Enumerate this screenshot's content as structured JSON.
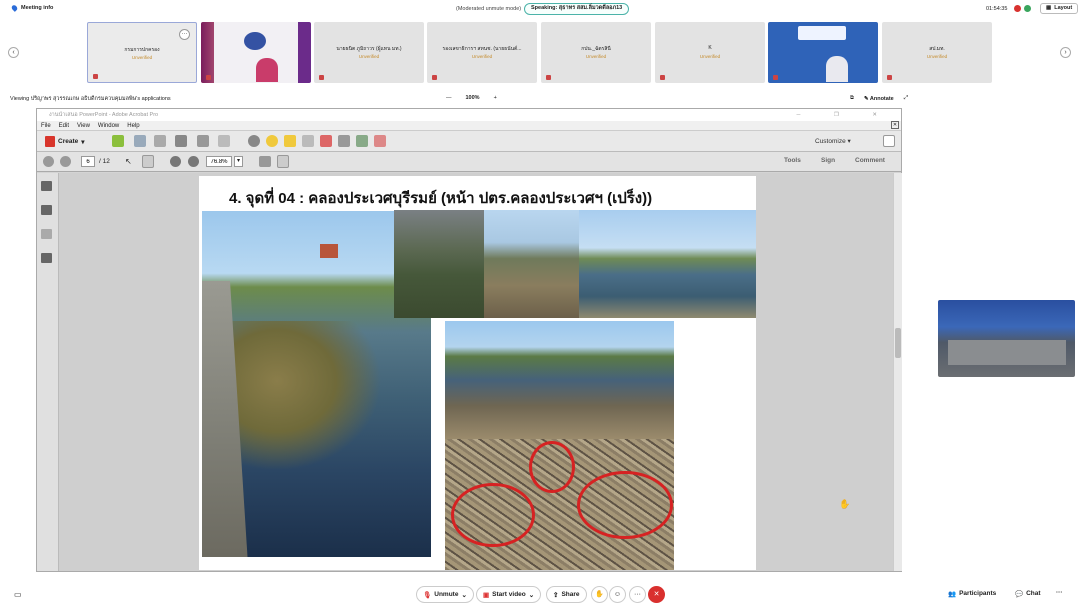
{
  "topbar": {
    "meeting_info": "Meeting info",
    "mode": "(Moderated unmute mode)",
    "speaking": "Speaking: สุธาทร สสม.ลิ่มวดดีลอภ13",
    "clock": "01:54:35",
    "layout": "Layout"
  },
  "gallery": {
    "tiles": [
      {
        "name": "กรมการปกครอง",
        "status": "Unverified"
      },
      {
        "name": "",
        "status": ""
      },
      {
        "name": "นายธนิต ภูมิถาวร (ผู้แทน มท.)",
        "status": "Unverified"
      },
      {
        "name": "รองเลขาธิการฯ สทนช. (นายธนันต์...",
        "status": "Unverified"
      },
      {
        "name": "กปน._ฉัตรสินี",
        "status": "Unverified"
      },
      {
        "name": "K",
        "status": "Unverified"
      },
      {
        "name": "",
        "status": ""
      },
      {
        "name": "สป.มท.",
        "status": "Unverified"
      }
    ]
  },
  "viewing": "Viewing ปริญาพร สุวรรณเกษ อธิบดีกรมควบคุมมลพิษ's applications",
  "zoom": {
    "minus": "—",
    "value": "100%",
    "plus": "+"
  },
  "annotate": "Annotate",
  "acrobat": {
    "title": "งานนำเสนอ PowerPoint - Adobe Acrobat Pro",
    "menu": [
      "File",
      "Edit",
      "View",
      "Window",
      "Help"
    ],
    "create": "Create",
    "customize": "Customize",
    "page_current": "6",
    "page_total": "/ 12",
    "zoom_value": "76.8%",
    "tools": [
      "Tools",
      "Sign",
      "Comment"
    ]
  },
  "slide": {
    "title": "4.   จุดที่ 04 : คลองประเวศบุรีรมย์ (หน้า ปตร.คลองประเวศฯ (เปร็ง))"
  },
  "bottom": {
    "unmute": "Unmute",
    "start_video": "Start video",
    "share": "Share",
    "participants": "Participants",
    "chat": "Chat"
  }
}
